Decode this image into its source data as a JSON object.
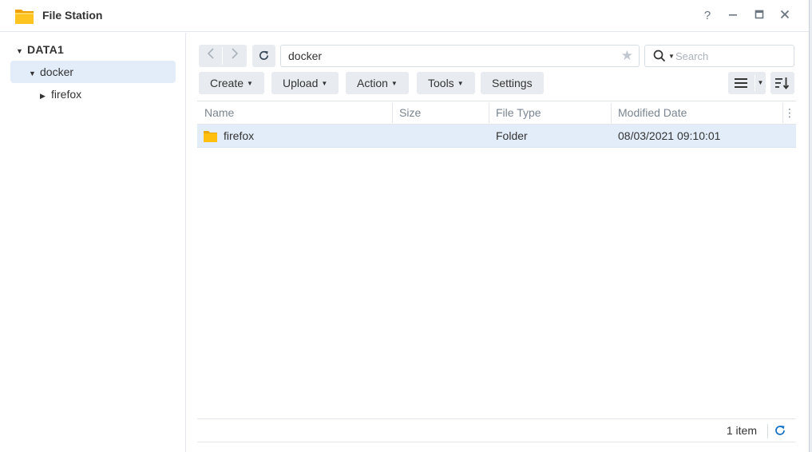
{
  "window": {
    "title": "File Station",
    "help_icon": "question-mark-icon",
    "minimize_icon": "minimize-icon",
    "maximize_icon": "maximize-icon",
    "close_icon": "close-icon"
  },
  "sidebar": {
    "root": {
      "label": "DATA1",
      "expanded": true
    },
    "items": [
      {
        "label": "docker",
        "selected": true,
        "expanded": true
      },
      {
        "label": "firefox",
        "selected": false,
        "expanded": false
      }
    ]
  },
  "toolbar": {
    "path": "docker",
    "search_placeholder": "Search",
    "buttons": {
      "create": "Create",
      "upload": "Upload",
      "action": "Action",
      "tools": "Tools",
      "settings": "Settings"
    }
  },
  "grid": {
    "columns": [
      "Name",
      "Size",
      "File Type",
      "Modified Date"
    ],
    "rows": [
      {
        "name": "firefox",
        "size": "",
        "type": "Folder",
        "modified": "08/03/2021 09:10:01",
        "selected": true
      }
    ]
  },
  "status": {
    "count": "1 item"
  },
  "colors": {
    "accent": "#1a73c8",
    "selection": "#e3edf9",
    "folder": "#f7b400"
  }
}
